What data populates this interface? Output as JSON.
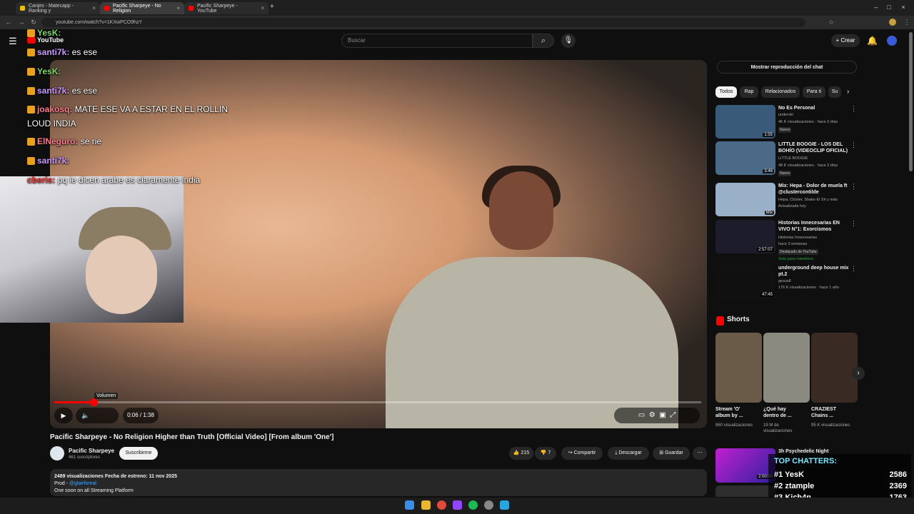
{
  "browser": {
    "tabs": [
      "Canjes - Matecapp - Ranking y",
      "Pacific Sharpeye - No Religion",
      "Pacific Sharpeye - YouTube"
    ],
    "url": "youtube.com/watch?v=1KXwPCO9hzY"
  },
  "header": {
    "logo": "YouTube",
    "search_placeholder": "Buscar",
    "create_label": "Crear"
  },
  "chat_overlay": [
    {
      "user": "YesK:",
      "text": ""
    },
    {
      "user": "santi7k:",
      "text": "es ese"
    },
    {
      "user": "YesK:",
      "text": ""
    },
    {
      "user": "santi7k:",
      "text": "es ese"
    },
    {
      "user": "joakosq:",
      "text": "MATE ESE VA A ESTAR EN EL ROLLIN LOUD INDIA"
    },
    {
      "user": "ElNeguro:",
      "text": "se rie"
    },
    {
      "user": "santi7k:",
      "text": ""
    },
    {
      "user": "cberis:",
      "text": "pq le dicen arabe es claramente india"
    }
  ],
  "player": {
    "time": "0:06 / 1:38",
    "progress": 0.061,
    "tooltip": "Volumen"
  },
  "video": {
    "title": "Pacific Sharpeye - No Religion Higher than Truth [Official Video] [From album 'One']",
    "channel": "Pacific Sharpeye",
    "subscribers": "461 suscriptores",
    "subscribe_label": "Suscribirme",
    "likes": "215",
    "dislikes": "7",
    "share_label": "Compartir",
    "download_label": "Descargar",
    "save_label": "Guardar",
    "description": {
      "stats": "2489 visualizaciones  Fecha de estreno: 11 nov 2025",
      "prod_prefix": "Prod - ",
      "prod_link": "@glairforeal",
      "line3": "One soon on all Streaming Platform"
    }
  },
  "sidebar": {
    "chat_replay_label": "Mostrar reproducción del chat",
    "chips": [
      "Todos",
      "Rap",
      "Relacionados",
      "Para ti",
      "Su"
    ],
    "recommendations": [
      {
        "title": "No Es Personal",
        "channel": "underski",
        "meta": "46 K visualizaciones · hace 3 días",
        "badge": "Nuevo",
        "duration": "1:55",
        "color": "#3a5a7a"
      },
      {
        "title": "LITTLE BOOGIE - LOS DEL BOHÍO (VIDEOCLIP OFICIAL)",
        "channel": "LITTLE BOOGIE",
        "meta": "48 K visualizaciones · hace 3 días",
        "badge": "Nuevo",
        "duration": "3:48",
        "color": "#4a6a88"
      },
      {
        "title": "Mix: Hepa - Dolor de muela ft @clustercontilde",
        "channel": "Hepa, Clüster, Shako El Sh y más",
        "meta": "Actualizada hoy",
        "badge": "",
        "duration": "Mix",
        "color": "#9ab0c8"
      },
      {
        "title": "Historias Innecesarias EN VIVO N°1: Exorcismos",
        "channel": "Historias Innecesarias",
        "meta": "hace 3 semanas",
        "badge": "Destacado de YouTube",
        "extra": "Solo para miembros",
        "duration": "2:57:07",
        "color": "#1c1c2a"
      },
      {
        "title": "underground deep house mix pt.2",
        "channel": "gesus8",
        "meta": "176 K visualizaciones · hace 1 año",
        "badge": "",
        "duration": "47:45",
        "color": "#101010"
      }
    ],
    "shorts_title": "Shorts",
    "shorts": [
      {
        "title": "Stream 'O' album by ...",
        "views": "860 visualizaciones",
        "color": "#6a5a48"
      },
      {
        "title": "¿Qué hay dentro de ...",
        "views": "19 M de visualizaciones",
        "color": "#8a8a80"
      },
      {
        "title": "CRAZIEST Chains ...",
        "views": "95 K visualizaciones",
        "color": "#3a2a24"
      }
    ],
    "next_title": "3h Psychedelic Night",
    "next_duration": "2:00:00"
  },
  "top_chatters": {
    "title": "TOP CHATTERS:",
    "rows": [
      {
        "rank": "#1",
        "name": "YesK",
        "value": "2586"
      },
      {
        "rank": "#2",
        "name": "ztample",
        "value": "2369"
      },
      {
        "rank": "#3",
        "name": "Kich4n",
        "value": "1763"
      }
    ]
  }
}
